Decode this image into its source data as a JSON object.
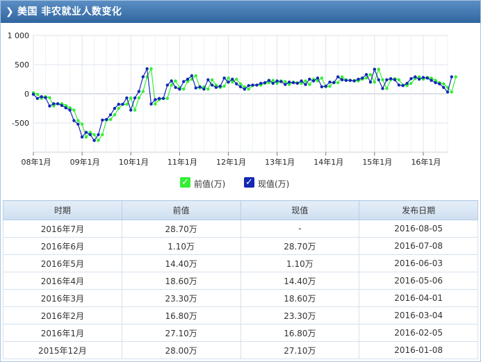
{
  "header": {
    "title": "美国 非农就业人数变化"
  },
  "legend": {
    "prev_label": "前值(万)",
    "curr_label": "现值(万)"
  },
  "colors": {
    "prev": "#33ee33",
    "curr": "#1428b4",
    "header": "#3a6ea8"
  },
  "chart_data": {
    "type": "line",
    "x": [
      "08年1月",
      "08年2月",
      "08年3月",
      "08年4月",
      "08年5月",
      "08年6月",
      "08年7月",
      "08年8月",
      "08年9月",
      "08年10月",
      "08年11月",
      "08年12月",
      "09年1月",
      "09年2月",
      "09年3月",
      "09年4月",
      "09年5月",
      "09年6月",
      "09年7月",
      "09年8月",
      "09年9月",
      "09年10月",
      "09年11月",
      "09年12月",
      "10年1月",
      "10年2月",
      "10年3月",
      "10年4月",
      "10年5月",
      "10年6月",
      "10年7月",
      "10年8月",
      "10年9月",
      "10年10月",
      "10年11月",
      "10年12月",
      "11年1月",
      "11年2月",
      "11年3月",
      "11年4月",
      "11年5月",
      "11年6月",
      "11年7月",
      "11年8月",
      "11年9月",
      "11年10月",
      "11年11月",
      "11年12月",
      "12年1月",
      "12年2月",
      "12年3月",
      "12年4月",
      "12年5月",
      "12年6月",
      "12年7月",
      "12年8月",
      "12年9月",
      "12年10月",
      "12年11月",
      "12年12月",
      "13年1月",
      "13年2月",
      "13年3月",
      "13年4月",
      "13年5月",
      "13年6月",
      "13年7月",
      "13年8月",
      "13年9月",
      "13年10月",
      "13年11月",
      "13年12月",
      "14年1月",
      "14年2月",
      "14年3月",
      "14年4月",
      "14年5月",
      "14年6月",
      "14年7月",
      "14年8月",
      "14年9月",
      "14年10月",
      "14年11月",
      "14年12月",
      "15年1月",
      "15年2月",
      "15年3月",
      "15年4月",
      "15年5月",
      "15年6月",
      "15年7月",
      "15年8月",
      "15年9月",
      "15年10月",
      "15年11月",
      "15年12月",
      "16年1月",
      "16年2月",
      "16年3月",
      "16年4月",
      "16年5月",
      "16年6月",
      "16年7月"
    ],
    "series": [
      {
        "name": "前值(万)",
        "values": [
          18,
          -8,
          -80,
          -50,
          -67,
          -210,
          -170,
          -170,
          -200,
          -240,
          -280,
          -460,
          -520,
          -740,
          -660,
          -700,
          -800,
          -700,
          -450,
          -440,
          -360,
          -250,
          -180,
          -180,
          -70,
          -280,
          -70,
          40,
          290,
          430,
          -175,
          -100,
          -80,
          -80,
          150,
          220,
          110,
          80,
          210,
          250,
          310,
          100,
          120,
          80,
          240,
          150,
          110,
          130,
          270,
          200,
          250,
          170,
          120,
          80,
          140,
          150,
          150,
          180,
          190,
          230,
          180,
          220,
          210,
          160,
          200,
          190,
          180,
          220,
          160,
          250,
          220,
          270,
          120,
          130,
          200,
          190,
          290,
          240,
          230,
          230,
          220,
          250,
          270,
          330,
          200,
          420,
          240,
          90,
          240,
          260,
          240,
          150,
          140,
          180,
          260,
          290,
          250,
          280,
          270,
          230,
          190,
          170,
          110,
          30,
          290
        ],
        "values_note": ""
      },
      {
        "name": "现值(万)",
        "values": [
          -8,
          -80,
          -50,
          -67,
          -210,
          -170,
          -170,
          -200,
          -240,
          -280,
          -460,
          -520,
          -740,
          -660,
          -700,
          -800,
          -700,
          -450,
          -440,
          -360,
          -250,
          -180,
          -180,
          -70,
          -280,
          -70,
          40,
          290,
          430,
          -175,
          -100,
          -80,
          -80,
          150,
          220,
          110,
          80,
          210,
          250,
          310,
          100,
          120,
          80,
          240,
          150,
          110,
          130,
          270,
          200,
          250,
          170,
          120,
          80,
          140,
          150,
          150,
          180,
          190,
          230,
          180,
          220,
          210,
          160,
          200,
          190,
          180,
          220,
          160,
          250,
          220,
          270,
          120,
          130,
          200,
          190,
          290,
          240,
          230,
          230,
          220,
          250,
          270,
          330,
          200,
          420,
          240,
          90,
          240,
          260,
          240,
          150,
          140,
          180,
          260,
          290,
          250,
          280,
          270,
          230,
          190,
          170,
          110,
          30,
          290,
          null
        ]
      }
    ],
    "y_ticks": [
      "1 000",
      "500",
      "0",
      "-500"
    ],
    "x_ticks": [
      "08年1月",
      "09年1月",
      "10年1月",
      "11年1月",
      "12年1月",
      "13年1月",
      "14年1月",
      "15年1月",
      "16年1月"
    ],
    "ylim": [
      -1000,
      1000
    ],
    "grid": true,
    "legend_position": "bottom"
  },
  "table": {
    "headers": [
      "时期",
      "前值",
      "现值",
      "发布日期"
    ],
    "rows": [
      [
        "2016年7月",
        "28.70万",
        "-",
        "2016-08-05"
      ],
      [
        "2016年6月",
        "1.10万",
        "28.70万",
        "2016-07-08"
      ],
      [
        "2016年5月",
        "14.40万",
        "1.10万",
        "2016-06-03"
      ],
      [
        "2016年4月",
        "18.60万",
        "14.40万",
        "2016-05-06"
      ],
      [
        "2016年3月",
        "23.30万",
        "18.60万",
        "2016-04-01"
      ],
      [
        "2016年2月",
        "16.80万",
        "23.30万",
        "2016-03-04"
      ],
      [
        "2016年1月",
        "27.10万",
        "16.80万",
        "2016-02-05"
      ],
      [
        "2015年12月",
        "28.00万",
        "27.10万",
        "2016-01-08"
      ]
    ]
  }
}
